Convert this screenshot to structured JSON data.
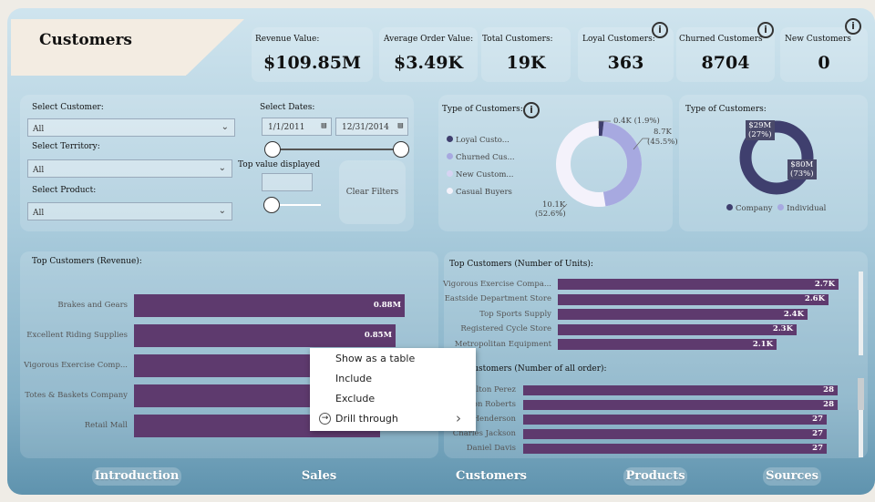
{
  "page": {
    "title": "Customers"
  },
  "kpis": [
    {
      "label": "Revenue Value:",
      "value": "$109.85M"
    },
    {
      "label": "Average Order Value:",
      "value": "$3.49K"
    },
    {
      "label": "Total Customers:",
      "value": "19K"
    },
    {
      "label": "Loyal Customers:",
      "value": "363"
    },
    {
      "label": "Churned Customers",
      "value": "8704"
    },
    {
      "label": "New Customers",
      "value": "0"
    }
  ],
  "filters": {
    "customer_label": "Select Customer:",
    "customer_value": "All",
    "territory_label": "Select Territory:",
    "territory_value": "All",
    "product_label": "Select Product:",
    "product_value": "All",
    "dates_label": "Select Dates:",
    "date_start": "1/1/2011",
    "date_end": "12/31/2014",
    "topvalue_label": "Top value displayed",
    "topvalue_value": "",
    "clear_label": "Clear Filters"
  },
  "type_donut": {
    "title": "Type of Customers:",
    "legend": [
      "Loyal Custo...",
      "Churned Cus...",
      "New Custom...",
      "Casual Buyers"
    ],
    "label_top": "0.4K (1.9%)",
    "label_right_a": "8.7K",
    "label_right_b": "(45.5%)",
    "label_bottom_a": "10.1K",
    "label_bottom_b": "(52.6%)",
    "colors": [
      "#3f3f6e",
      "#a7a9e0",
      "#d6d3f2",
      "#f4f2fb"
    ]
  },
  "segment_donut": {
    "title": "Type of Customers:",
    "label_a_1": "$29M",
    "label_a_2": "(27%)",
    "label_b_1": "$80M",
    "label_b_2": "(73%)",
    "legend": [
      "Company",
      "Individual"
    ],
    "colors": [
      "#3f3f6e",
      "#a7a9e0"
    ]
  },
  "chart_data": [
    {
      "type": "bar",
      "title": "Top Customers (Revenue):",
      "categories": [
        "Brakes and Gears",
        "Excellent Riding Supplies",
        "Vigorous Exercise Comp...",
        "Totes & Baskets Company",
        "Retail Mall"
      ],
      "values": [
        0.88,
        0.85,
        0.82,
        0.81,
        0.8
      ],
      "value_labels": [
        "0.88M",
        "0.85M",
        "",
        "",
        "0.80M"
      ],
      "unit": "M"
    },
    {
      "type": "bar",
      "title": "Top Customers (Number of Units):",
      "categories": [
        "Vigorous Exercise Compa...",
        "Eastside Department Store",
        "Top Sports Supply",
        "Registered Cycle Store",
        "Metropolitan Equipment"
      ],
      "values": [
        2.7,
        2.6,
        2.4,
        2.3,
        2.1
      ],
      "value_labels": [
        "2.7K",
        "2.6K",
        "2.4K",
        "2.3K",
        "2.1K"
      ],
      "unit": "K"
    },
    {
      "type": "bar",
      "title": "Top Customers (Number of all order):",
      "categories": [
        "Dalton Perez",
        "Mason Roberts",
        "Henderson",
        "Charles Jackson",
        "Daniel Davis"
      ],
      "values": [
        28,
        28,
        27,
        27,
        27
      ],
      "value_labels": [
        "28",
        "28",
        "27",
        "27",
        "27"
      ]
    }
  ],
  "context_menu": {
    "items": [
      "Show as a table",
      "Include",
      "Exclude",
      "Drill through"
    ],
    "submenu_arrow": "›"
  },
  "nav": [
    "Introduction",
    "Sales",
    "Customers",
    "Products",
    "Sources"
  ],
  "info_glyph": "i",
  "colors": {
    "bar": "#5e3a6e",
    "bar_alt": "#5b3a6c"
  }
}
